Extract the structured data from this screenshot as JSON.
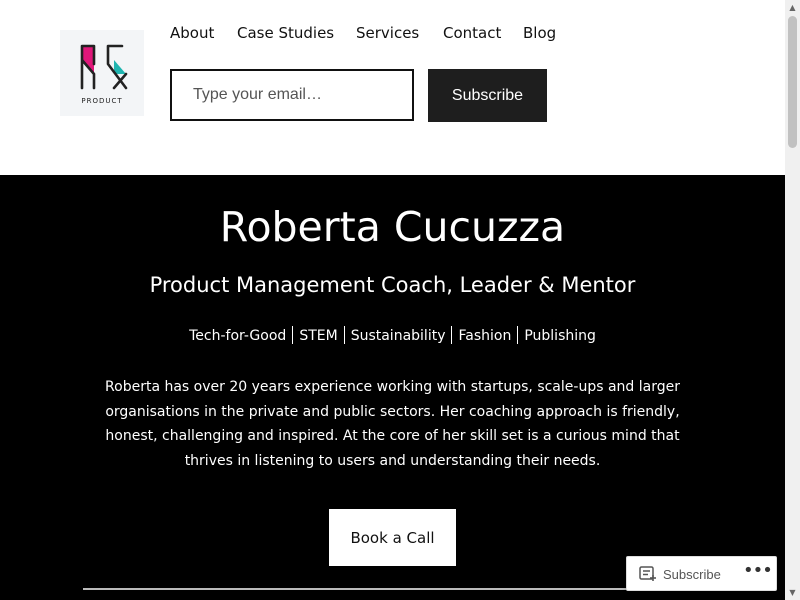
{
  "header": {
    "logo": {
      "icon": "rc-monogram-logo",
      "text": "PRODUCT",
      "colors": {
        "pink": "#e0177a",
        "teal": "#1fb5b0",
        "ink": "#222222"
      }
    },
    "nav": [
      {
        "label": "About"
      },
      {
        "label": "Case Studies"
      },
      {
        "label": "Services"
      },
      {
        "label": "Contact"
      },
      {
        "label": "Blog"
      }
    ],
    "email_form": {
      "placeholder": "Type your email…",
      "value": "",
      "button_label": "Subscribe"
    }
  },
  "hero": {
    "name": "Roberta Cucuzza",
    "tagline": "Product Management Coach, Leader & Mentor",
    "tags": [
      "Tech-for-Good",
      "STEM",
      "Sustainability",
      "Fashion",
      "Publishing"
    ],
    "bio": "Roberta has over 20 years experience working with startups, scale-ups and larger organisations in the private and public sectors. Her coaching approach is friendly, honest, challenging and inspired. At the core of her skill set is a curious mind that thrives in listening to users and understanding their needs.",
    "cta_label": "Book a Call",
    "background": "#000000"
  },
  "floating_bar": {
    "subscribe_label": "Subscribe",
    "subscribe_icon": "reader-subscribe-icon",
    "more_icon": "ellipsis-icon"
  }
}
